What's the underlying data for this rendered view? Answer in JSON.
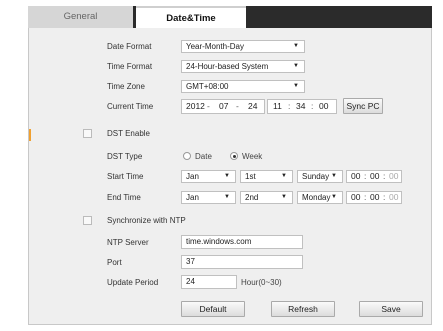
{
  "tabs": {
    "general": "General",
    "datetime": "Date&Time"
  },
  "labels": {
    "date_format": "Date Format",
    "time_format": "Time Format",
    "time_zone": "Time Zone",
    "current_time": "Current Time",
    "dst_enable": "DST Enable",
    "dst_type": "DST Type",
    "start_time": "Start Time",
    "end_time": "End Time",
    "sync_ntp": "Synchronize with NTP",
    "ntp_server": "NTP Server",
    "port": "Port",
    "update_period": "Update Period"
  },
  "values": {
    "date_format": "Year-Month-Day",
    "time_format": "24-Hour-based System",
    "time_zone": "GMT+08:00",
    "current": {
      "year": "2012",
      "month": "07",
      "day": "24",
      "hour": "11",
      "minute": "34",
      "second": "00"
    },
    "dst_type_date": "Date",
    "dst_type_week": "Week",
    "dst_type_selected": "Week",
    "start": {
      "month": "Jan",
      "week": "1st",
      "weekday": "Sunday",
      "hh": "00",
      "mm": "00",
      "ss": "00"
    },
    "end": {
      "month": "Jan",
      "week": "2nd",
      "weekday": "Monday",
      "hh": "00",
      "mm": "00",
      "ss": "00"
    },
    "ntp_server": "time.windows.com",
    "port": "37",
    "update_period": "24",
    "update_period_hint": "Hour(0~30)"
  },
  "checkboxes": {
    "dst_enable": false,
    "sync_ntp": false
  },
  "buttons": {
    "sync_pc": "Sync PC",
    "default": "Default",
    "refresh": "Refresh",
    "save": "Save"
  },
  "separators": {
    "date": "-",
    "time": ":"
  },
  "icons": {
    "dropdown": "chevron-down-icon"
  },
  "colors": {
    "tab_bar": "#2b2b2b",
    "panel": "#efefef",
    "accent": "#f0a030"
  }
}
